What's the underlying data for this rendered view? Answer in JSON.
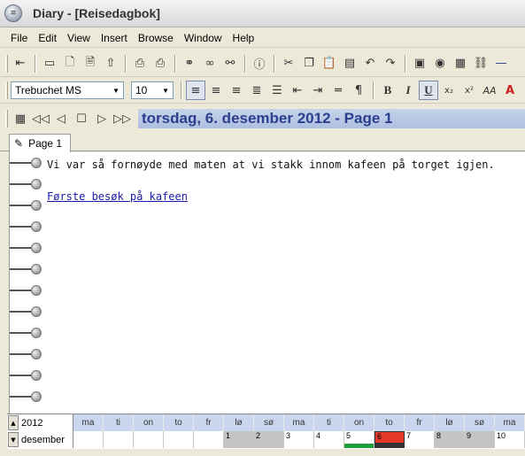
{
  "window": {
    "title": "Diary - [Reisedagbok]"
  },
  "menu": [
    "File",
    "Edit",
    "View",
    "Insert",
    "Browse",
    "Window",
    "Help"
  ],
  "toolbar1": {
    "icons": [
      "back-icon",
      "open-icon",
      "new-page-icon",
      "new-entry-icon",
      "up-icon",
      "print-preview-icon",
      "print-icon",
      "find-icon",
      "binoculars-icon",
      "find-next-icon",
      "info-icon",
      "cut-icon",
      "copy-icon",
      "paste-icon",
      "paste-special-icon",
      "undo-icon",
      "redo-icon",
      "insert-picture-icon",
      "insert-globe-icon",
      "insert-date-icon",
      "link-icon",
      "line-icon"
    ]
  },
  "format": {
    "font": "Trebuchet MS",
    "size": "10",
    "bold": "B",
    "italic": "I",
    "underline": "U",
    "subscript": "x₂",
    "superscript": "x²"
  },
  "nav": {
    "date_text": "torsdag, 6. desember 2012 - Page 1"
  },
  "tab": {
    "label": "Page 1"
  },
  "entry": {
    "text": "Vi var så fornøyde med maten at vi stakk innom kafeen på torget igjen.",
    "link": "Første besøk på kafeen"
  },
  "calendar": {
    "year": "2012",
    "month": "desember",
    "day_headers": [
      "ma",
      "ti",
      "on",
      "to",
      "fr",
      "lø",
      "sø",
      "ma",
      "ti",
      "on",
      "to",
      "fr",
      "lø",
      "sø",
      "ma"
    ],
    "days": [
      "",
      "",
      "",
      "",
      "",
      "1",
      "2",
      "3",
      "4",
      "5",
      "6",
      "7",
      "8",
      "9",
      "10"
    ],
    "weekend_color": "#c4c4c4",
    "entry_marker_color": "#1f9e3a",
    "today_color": "#e4392a",
    "selected_day": "6"
  }
}
